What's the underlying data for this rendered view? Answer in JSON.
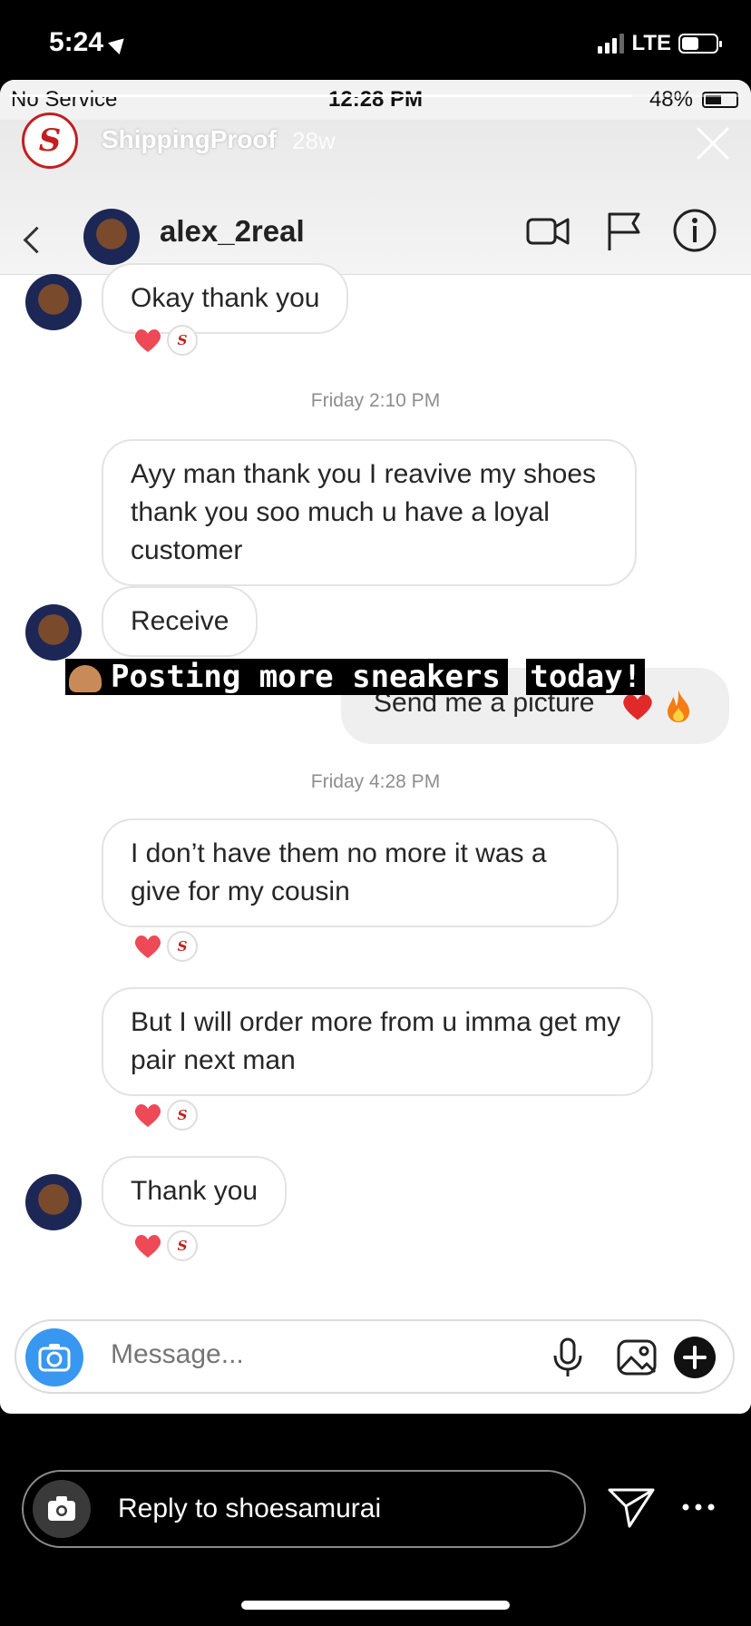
{
  "os_status": {
    "time": "5:24",
    "network": "LTE"
  },
  "story": {
    "username": "ShippingProof",
    "age": "28w",
    "progress_fraction": 0.85
  },
  "inner_status": {
    "carrier": "No Service",
    "time": "12:28 PM",
    "battery": "48%"
  },
  "dm_header": {
    "name": "alex_2real"
  },
  "messages": {
    "m1": "Okay thank you",
    "t1": "Friday 2:10 PM",
    "m2": "Ayy man thank you I reavive my shoes thank you soo much u have a loyal customer",
    "m3": "Receive",
    "m4": "Send me a picture",
    "t2": "Friday 4:28 PM",
    "m5": "I don’t have them no more it was a give for my cousin",
    "m6": "But I will order more from u imma get my pair next man",
    "m7": "Thank you"
  },
  "caption": {
    "line1": "Posting more sneakers",
    "line2": "today!"
  },
  "composer": {
    "placeholder": "Message..."
  },
  "reply": {
    "text": "Reply to shoesamurai"
  },
  "colors": {
    "heart": "#ed4956",
    "brand_red": "#c0201f",
    "camera_blue": "#3897f0"
  }
}
